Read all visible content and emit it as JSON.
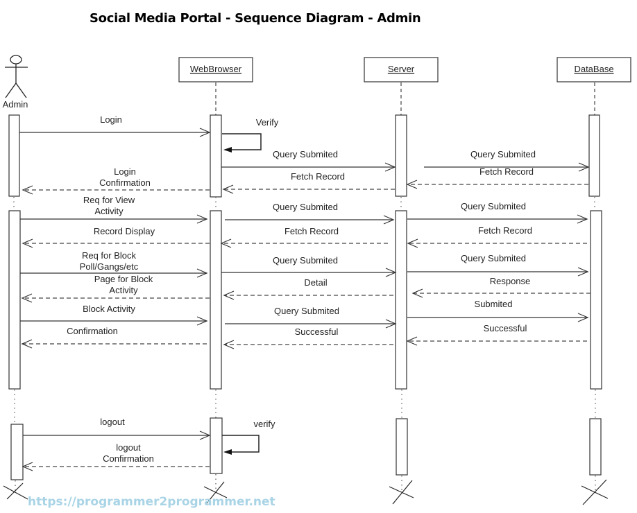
{
  "title": "Social Media Portal - Sequence Diagram - Admin",
  "watermark": "https://programmer2programmer.net",
  "actor": {
    "label": "Admin",
    "icon": "stick-figure-icon"
  },
  "lifelines": [
    {
      "id": "webbrowser",
      "label": "WebBrowser"
    },
    {
      "id": "server",
      "label": "Server"
    },
    {
      "id": "database",
      "label": "DataBase"
    }
  ],
  "messages": [
    {
      "from": "admin",
      "to": "webbrowser",
      "type": "sync",
      "lines": [
        "Login"
      ]
    },
    {
      "from": "webbrowser",
      "to": "webbrowser",
      "type": "self",
      "lines": [
        "Verify"
      ]
    },
    {
      "from": "webbrowser",
      "to": "server",
      "type": "sync",
      "lines": [
        "Query Submited"
      ]
    },
    {
      "from": "server",
      "to": "database",
      "type": "sync",
      "lines": [
        "Query Submited"
      ]
    },
    {
      "from": "database",
      "to": "server",
      "type": "return",
      "lines": [
        "Fetch Record"
      ]
    },
    {
      "from": "server",
      "to": "webbrowser",
      "type": "return",
      "lines": [
        "Fetch Record"
      ]
    },
    {
      "from": "webbrowser",
      "to": "admin",
      "type": "return",
      "lines": [
        "Login",
        "Confirmation"
      ]
    },
    {
      "from": "admin",
      "to": "webbrowser",
      "type": "sync",
      "lines": [
        "Req for View",
        "Activity"
      ]
    },
    {
      "from": "webbrowser",
      "to": "server",
      "type": "sync",
      "lines": [
        "Query Submited"
      ]
    },
    {
      "from": "server",
      "to": "database",
      "type": "sync",
      "lines": [
        "Query Submited"
      ]
    },
    {
      "from": "database",
      "to": "server",
      "type": "return",
      "lines": [
        "Fetch Record"
      ]
    },
    {
      "from": "server",
      "to": "webbrowser",
      "type": "return",
      "lines": [
        "Fetch Record"
      ]
    },
    {
      "from": "webbrowser",
      "to": "admin",
      "type": "return",
      "lines": [
        "Record Display"
      ]
    },
    {
      "from": "admin",
      "to": "webbrowser",
      "type": "sync",
      "lines": [
        "Req for Block",
        "Poll/Gangs/etc"
      ]
    },
    {
      "from": "webbrowser",
      "to": "server",
      "type": "sync",
      "lines": [
        "Query Submited"
      ]
    },
    {
      "from": "server",
      "to": "database",
      "type": "sync",
      "lines": [
        "Query Submited"
      ]
    },
    {
      "from": "database",
      "to": "server",
      "type": "return",
      "lines": [
        "Response"
      ]
    },
    {
      "from": "server",
      "to": "webbrowser",
      "type": "return",
      "lines": [
        "Detail"
      ]
    },
    {
      "from": "webbrowser",
      "to": "admin",
      "type": "return",
      "lines": [
        "Page for Block",
        "Activity"
      ]
    },
    {
      "from": "admin",
      "to": "webbrowser",
      "type": "sync",
      "lines": [
        "Block Activity"
      ]
    },
    {
      "from": "webbrowser",
      "to": "server",
      "type": "sync",
      "lines": [
        "Query Submited"
      ]
    },
    {
      "from": "server",
      "to": "database",
      "type": "sync",
      "lines": [
        "Submited"
      ]
    },
    {
      "from": "database",
      "to": "server",
      "type": "return",
      "lines": [
        "Successful"
      ]
    },
    {
      "from": "server",
      "to": "webbrowser",
      "type": "return",
      "lines": [
        "Successful"
      ]
    },
    {
      "from": "webbrowser",
      "to": "admin",
      "type": "return",
      "lines": [
        "Confirmation"
      ]
    },
    {
      "from": "admin",
      "to": "webbrowser",
      "type": "sync",
      "lines": [
        "logout"
      ]
    },
    {
      "from": "webbrowser",
      "to": "webbrowser",
      "type": "self",
      "lines": [
        "verify"
      ]
    },
    {
      "from": "webbrowser",
      "to": "admin",
      "type": "return",
      "lines": [
        "logout",
        "Confirmation"
      ]
    }
  ]
}
